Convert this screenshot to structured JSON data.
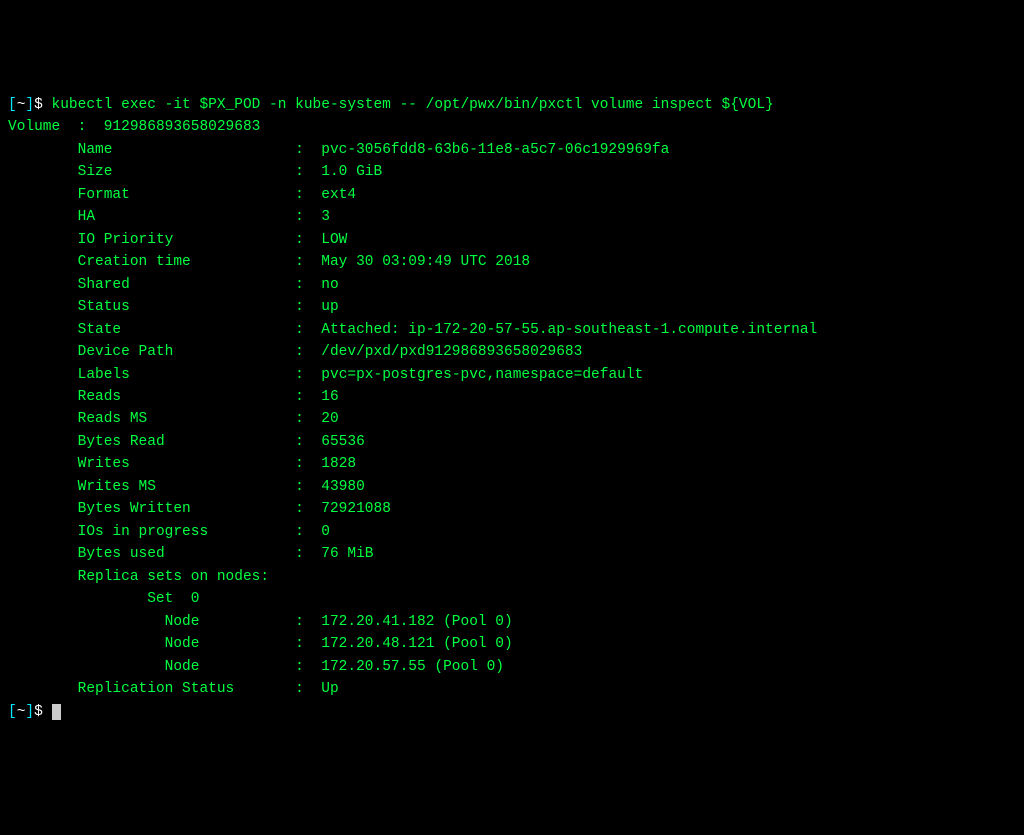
{
  "prompt1": {
    "bracket_open": "[",
    "path": "~",
    "bracket_close": "]",
    "dollar": "$ ",
    "command": "kubectl exec -it $PX_POD -n kube-system -- /opt/pwx/bin/pxctl volume inspect ${VOL}"
  },
  "volume_header": {
    "label": "Volume",
    "sep": "  :  ",
    "id": "912986893658029683"
  },
  "fields": [
    {
      "label": "Name",
      "pad": "                    ",
      "value": "pvc-3056fdd8-63b6-11e8-a5c7-06c1929969fa"
    },
    {
      "label": "Size",
      "pad": "                    ",
      "value": "1.0 GiB"
    },
    {
      "label": "Format",
      "pad": "                  ",
      "value": "ext4"
    },
    {
      "label": "HA",
      "pad": "                      ",
      "value": "3"
    },
    {
      "label": "IO Priority",
      "pad": "             ",
      "value": "LOW"
    },
    {
      "label": "Creation time",
      "pad": "           ",
      "value": "May 30 03:09:49 UTC 2018"
    },
    {
      "label": "Shared",
      "pad": "                  ",
      "value": "no"
    },
    {
      "label": "Status",
      "pad": "                  ",
      "value": "up"
    },
    {
      "label": "State",
      "pad": "                   ",
      "value": "Attached: ip-172-20-57-55.ap-southeast-1.compute.internal"
    },
    {
      "label": "Device Path",
      "pad": "             ",
      "value": "/dev/pxd/pxd912986893658029683"
    },
    {
      "label": "Labels",
      "pad": "                  ",
      "value": "pvc=px-postgres-pvc,namespace=default"
    },
    {
      "label": "Reads",
      "pad": "                   ",
      "value": "16"
    },
    {
      "label": "Reads MS",
      "pad": "                ",
      "value": "20"
    },
    {
      "label": "Bytes Read",
      "pad": "              ",
      "value": "65536"
    },
    {
      "label": "Writes",
      "pad": "                  ",
      "value": "1828"
    },
    {
      "label": "Writes MS",
      "pad": "               ",
      "value": "43980"
    },
    {
      "label": "Bytes Written",
      "pad": "           ",
      "value": "72921088"
    },
    {
      "label": "IOs in progress",
      "pad": "         ",
      "value": "0"
    },
    {
      "label": "Bytes used",
      "pad": "              ",
      "value": "76 MiB"
    }
  ],
  "replica_header": "Replica sets on nodes:",
  "set_label": "Set  0",
  "nodes": [
    {
      "label": "Node",
      "value": "172.20.41.182 (Pool 0)"
    },
    {
      "label": "Node",
      "value": "172.20.48.121 (Pool 0)"
    },
    {
      "label": "Node",
      "value": "172.20.57.55 (Pool 0)"
    }
  ],
  "replication_status": {
    "label": "Replication Status",
    "pad": "      ",
    "value": "Up"
  },
  "prompt2": {
    "bracket_open": "[",
    "path": "~",
    "bracket_close": "]",
    "dollar": "$ "
  }
}
